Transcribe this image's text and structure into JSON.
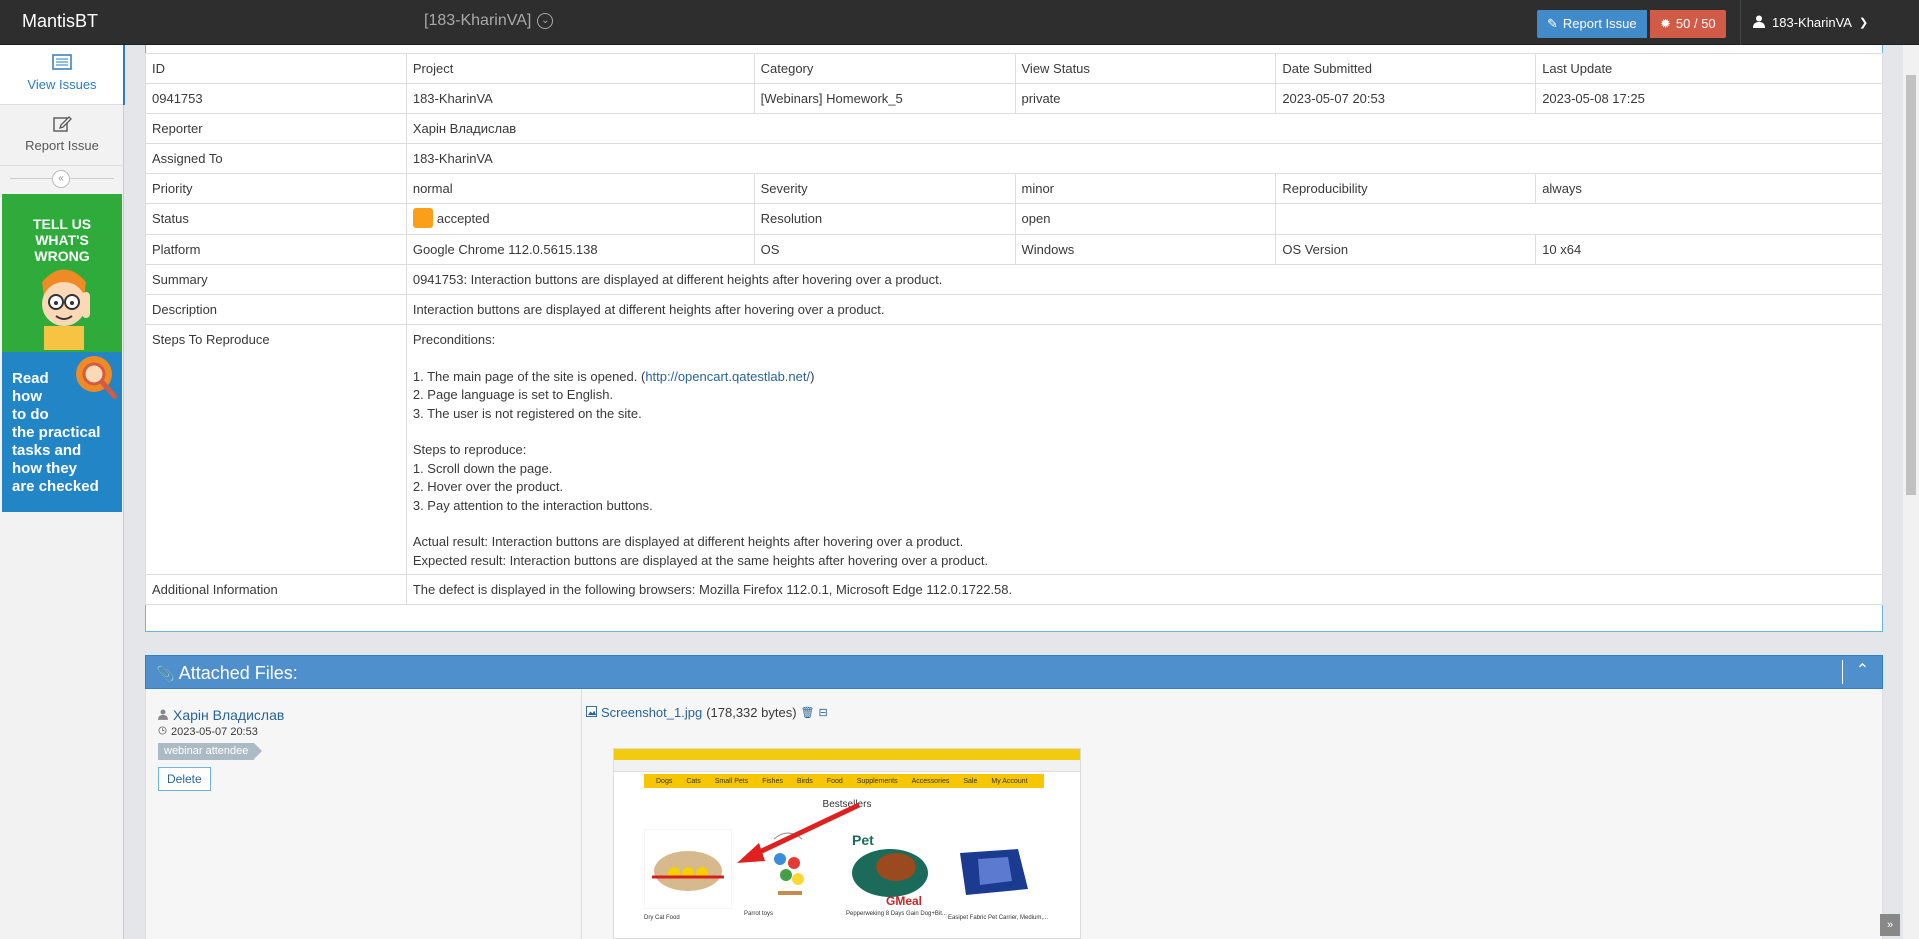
{
  "navbar": {
    "brand": "MantisBT",
    "project": "[183-KharinVA]",
    "report_issue": "Report Issue",
    "count": "50 / 50",
    "user": "183-KharinVA"
  },
  "sidebar": {
    "items": [
      {
        "label": "View Issues",
        "icon": "list-icon"
      },
      {
        "label": "Report Issue",
        "icon": "edit-icon"
      }
    ],
    "banner_green": [
      "TELL US",
      "WHAT'S",
      "WRONG"
    ],
    "banner_blue": [
      "Read",
      "how",
      "to do",
      "the practical",
      "tasks and",
      "how they",
      "are checked"
    ]
  },
  "details": {
    "headers": [
      "ID",
      "Project",
      "Category",
      "View Status",
      "Date Submitted",
      "Last Update"
    ],
    "values": [
      "0941753",
      "183-KharinVA",
      "[Webinars] Homework_5",
      "private",
      "2023-05-07 20:53",
      "2023-05-08 17:25"
    ],
    "reporter_label": "Reporter",
    "reporter": "Харін Владислав",
    "assigned_label": "Assigned To",
    "assigned": "183-KharinVA",
    "priority_label": "Priority",
    "priority": "normal",
    "severity_label": "Severity",
    "severity": "minor",
    "reproducibility_label": "Reproducibility",
    "reproducibility": "always",
    "status_label": "Status",
    "status": "accepted",
    "status_color": "#fb9f1a",
    "resolution_label": "Resolution",
    "resolution": "open",
    "platform_label": "Platform",
    "platform": "Google Chrome 112.0.5615.138",
    "os_label": "OS",
    "os": "Windows",
    "os_version_label": "OS Version",
    "os_version": "10 x64",
    "summary_label": "Summary",
    "summary": "0941753: Interaction buttons are displayed at different heights after hovering over a product.",
    "description_label": "Description",
    "description": "Interaction buttons are displayed at different heights after hovering over a product.",
    "steps_label": "Steps To Reproduce",
    "steps": {
      "preconditions": "Preconditions:",
      "p1_prefix": "1. The main page of the site is opened. (",
      "p1_link": "http://opencart.qatestlab.net/",
      "p1_suffix": ")",
      "p2": "2. Page language is set to English.",
      "p3": "3. The user is not registered on the site.",
      "steps_title": "Steps to reproduce:",
      "s1": "1. Scroll down the page.",
      "s2": "2. Hover over the product.",
      "s3": "3. Pay attention to the interaction buttons.",
      "actual": "Actual result: Interaction buttons are displayed at different heights after hovering over a product.",
      "expected": "Expected result: Interaction buttons are displayed at the same heights after hovering over a product."
    },
    "additional_label": "Additional Information",
    "additional": "The defect is displayed in the following browsers: Mozilla Firefox 112.0.1, Microsoft Edge 112.0.1722.58."
  },
  "attachments": {
    "title": "Attached Files:",
    "uploader": "Харін Владислав",
    "date": "2023-05-07 20:53",
    "role": "webinar attendee",
    "delete": "Delete",
    "file_name": "Screenshot_1.jpg",
    "file_size": "(178,332 bytes)",
    "preview": {
      "nav": [
        "Dogs",
        "Cats",
        "Small Pets",
        "Fishes",
        "Birds",
        "Food",
        "Supplements",
        "Accessories",
        "Sale",
        "My Account"
      ],
      "title": "Bestsellers",
      "products": [
        "Dry Cat Food",
        "Parrot toys",
        "Pepperweking 8 Days Gain Dog+Bit...",
        "Easipet Fabric Pet Carrier, Medium,..."
      ],
      "brand_text": "GMeal"
    }
  }
}
